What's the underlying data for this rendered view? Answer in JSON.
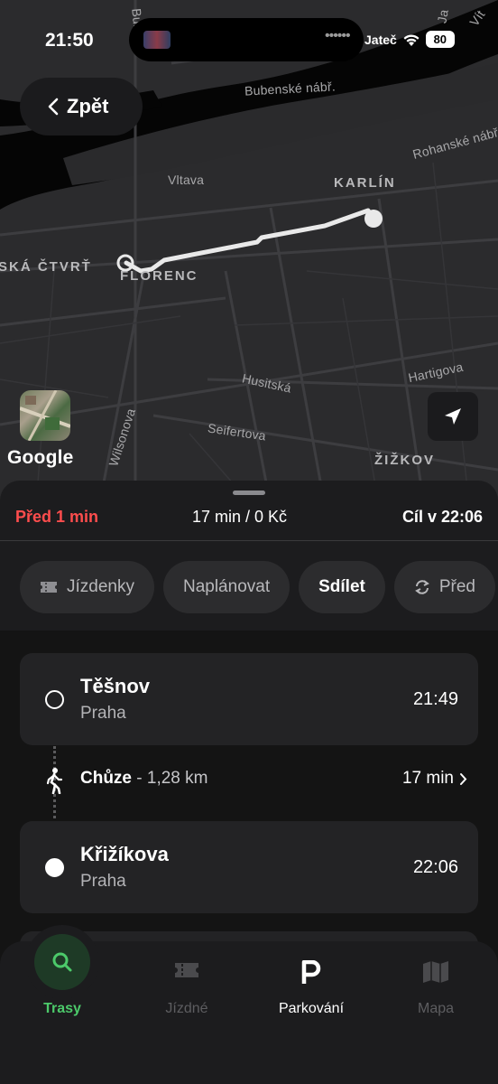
{
  "status_bar": {
    "time": "21:50",
    "carrier_text": "Jateč",
    "battery": "80"
  },
  "map": {
    "back_label": "Zpět",
    "provider": "Google",
    "labels": {
      "bubenske": "Bubenské nábř.",
      "rohanske": "Rohanské nábř.",
      "vltava": "Vltava",
      "karlin": "KARLÍN",
      "cvrt": "SKÁ ČTVRŤ",
      "florenc": "FLORENC",
      "hartigova": "Hartigova",
      "husitska": "Husitská",
      "wilsonova": "Wilsonova",
      "seifertova": "Seifertova",
      "zizkov": "ŽIŽKOV",
      "vit": "Vít",
      "ja": "Ja",
      "bube_v": "Bube"
    }
  },
  "summary": {
    "late": "Před 1 min",
    "duration_price": "17 min / 0 Kč",
    "arrival": "Cíl v 22:06"
  },
  "chips": [
    {
      "label": "Jízdenky",
      "icon": "ticket-icon"
    },
    {
      "label": "Naplánovat"
    },
    {
      "label": "Sdílet"
    },
    {
      "label": "Před",
      "icon": "refresh-icon"
    }
  ],
  "route": {
    "start": {
      "name": "Těšnov",
      "city": "Praha",
      "time": "21:49"
    },
    "walk": {
      "mode": "Chůze",
      "distance": "- 1,28 km",
      "duration": "17 min"
    },
    "end": {
      "name": "Křižíkova",
      "city": "Praha",
      "time": "22:06"
    }
  },
  "tabs": [
    {
      "label": "Trasy",
      "icon": "search-icon"
    },
    {
      "label": "Jízdné",
      "icon": "ticket-icon"
    },
    {
      "label": "Parkování",
      "icon": "parking-icon"
    },
    {
      "label": "Mapa",
      "icon": "map-icon"
    }
  ],
  "colors": {
    "accent_green": "#4cc96a",
    "late_red": "#ff4d4d",
    "map_bg": "#2b2b2d",
    "river": "#000000"
  }
}
